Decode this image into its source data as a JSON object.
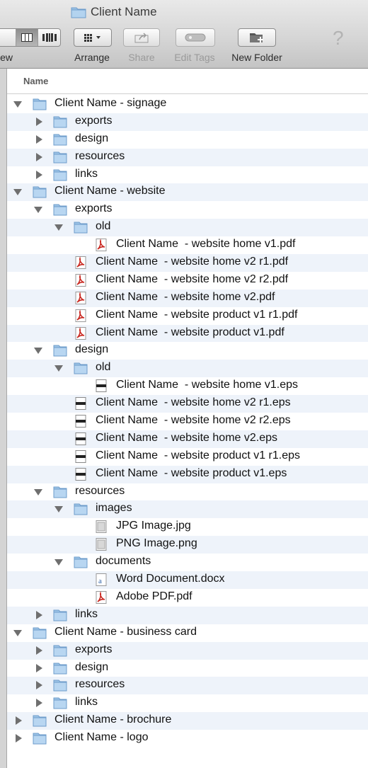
{
  "window": {
    "title": "Client Name"
  },
  "toolbar": {
    "view_label": "iew",
    "arrange_label": "Arrange",
    "share_label": "Share",
    "edit_tags_label": "Edit Tags",
    "new_folder_label": "New Folder",
    "help_glyph": "?"
  },
  "list": {
    "column_header": "Name",
    "rows": [
      {
        "name": "Client Name - signage",
        "depth": 0,
        "kind": "folder",
        "state": "open"
      },
      {
        "name": "exports",
        "depth": 1,
        "kind": "folder",
        "state": "closed"
      },
      {
        "name": "design",
        "depth": 1,
        "kind": "folder",
        "state": "closed"
      },
      {
        "name": "resources",
        "depth": 1,
        "kind": "folder",
        "state": "closed"
      },
      {
        "name": "links",
        "depth": 1,
        "kind": "folder",
        "state": "closed"
      },
      {
        "name": "Client Name - website",
        "depth": 0,
        "kind": "folder",
        "state": "open"
      },
      {
        "name": "exports",
        "depth": 1,
        "kind": "folder",
        "state": "open"
      },
      {
        "name": "old",
        "depth": 2,
        "kind": "folder",
        "state": "open"
      },
      {
        "name": "Client Name  - website home v1.pdf",
        "depth": 3,
        "kind": "pdf",
        "state": "none"
      },
      {
        "name": "Client Name  - website home v2 r1.pdf",
        "depth": 2,
        "kind": "pdf",
        "state": "none"
      },
      {
        "name": "Client Name  - website home v2 r2.pdf",
        "depth": 2,
        "kind": "pdf",
        "state": "none"
      },
      {
        "name": "Client Name  - website home v2.pdf",
        "depth": 2,
        "kind": "pdf",
        "state": "none"
      },
      {
        "name": "Client Name  - website product v1 r1.pdf",
        "depth": 2,
        "kind": "pdf",
        "state": "none"
      },
      {
        "name": "Client Name  - website product v1.pdf",
        "depth": 2,
        "kind": "pdf",
        "state": "none"
      },
      {
        "name": "design",
        "depth": 1,
        "kind": "folder",
        "state": "open"
      },
      {
        "name": "old",
        "depth": 2,
        "kind": "folder",
        "state": "open"
      },
      {
        "name": "Client Name  - website home v1.eps",
        "depth": 3,
        "kind": "eps",
        "state": "none"
      },
      {
        "name": "Client Name  - website home v2 r1.eps",
        "depth": 2,
        "kind": "eps",
        "state": "none"
      },
      {
        "name": "Client Name  - website home v2 r2.eps",
        "depth": 2,
        "kind": "eps",
        "state": "none"
      },
      {
        "name": "Client Name  - website home v2.eps",
        "depth": 2,
        "kind": "eps",
        "state": "none"
      },
      {
        "name": "Client Name  - website product v1 r1.eps",
        "depth": 2,
        "kind": "eps",
        "state": "none"
      },
      {
        "name": "Client Name  - website product v1.eps",
        "depth": 2,
        "kind": "eps",
        "state": "none"
      },
      {
        "name": "resources",
        "depth": 1,
        "kind": "folder",
        "state": "open"
      },
      {
        "name": "images",
        "depth": 2,
        "kind": "folder",
        "state": "open"
      },
      {
        "name": "JPG Image.jpg",
        "depth": 3,
        "kind": "image",
        "state": "none"
      },
      {
        "name": "PNG Image.png",
        "depth": 3,
        "kind": "image",
        "state": "none"
      },
      {
        "name": "documents",
        "depth": 2,
        "kind": "folder",
        "state": "open"
      },
      {
        "name": "Word Document.docx",
        "depth": 3,
        "kind": "word",
        "state": "none"
      },
      {
        "name": "Adobe PDF.pdf",
        "depth": 3,
        "kind": "pdf",
        "state": "none"
      },
      {
        "name": "links",
        "depth": 1,
        "kind": "folder",
        "state": "closed"
      },
      {
        "name": "Client Name - business card",
        "depth": 0,
        "kind": "folder",
        "state": "open"
      },
      {
        "name": "exports",
        "depth": 1,
        "kind": "folder",
        "state": "closed"
      },
      {
        "name": "design",
        "depth": 1,
        "kind": "folder",
        "state": "closed"
      },
      {
        "name": "resources",
        "depth": 1,
        "kind": "folder",
        "state": "closed"
      },
      {
        "name": "links",
        "depth": 1,
        "kind": "folder",
        "state": "closed"
      },
      {
        "name": "Client Name - brochure",
        "depth": 0,
        "kind": "folder",
        "state": "closed"
      },
      {
        "name": "Client Name - logo",
        "depth": 0,
        "kind": "folder",
        "state": "closed"
      }
    ]
  },
  "colors": {
    "folder": "#9cc3e6",
    "folder_dark": "#6e9ccb",
    "pdf": "#c8261e",
    "row_stripe": "#eef3fa"
  }
}
